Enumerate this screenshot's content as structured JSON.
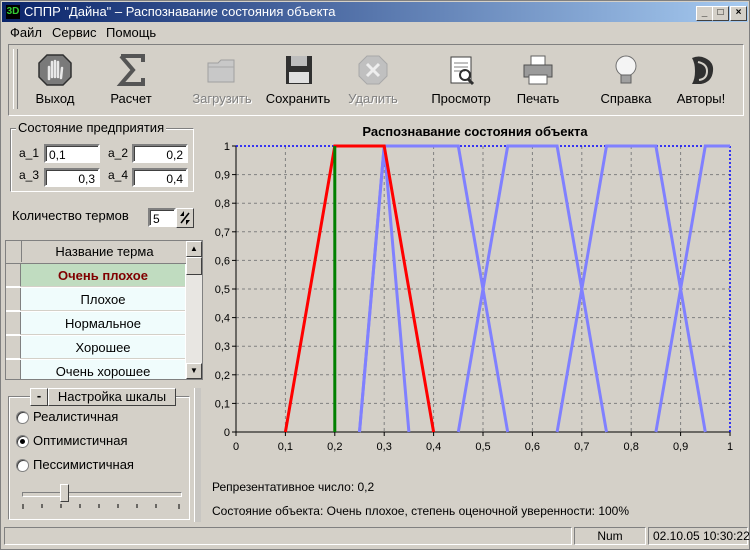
{
  "window": {
    "title": "СППР \"Дайна\" – Распознавание состояния объекта",
    "app_icon_text": "3D",
    "controls": {
      "minimize": "_",
      "maximize": "□",
      "close": "×"
    }
  },
  "menu": [
    "Файл",
    "Сервис",
    "Помощь"
  ],
  "toolbar": [
    {
      "label": "Выход",
      "icon": "exit-hand-icon",
      "enabled": true
    },
    {
      "label": "Расчет",
      "icon": "sigma-icon",
      "enabled": true
    },
    {
      "label": "Загрузить",
      "icon": "folder-icon",
      "enabled": false
    },
    {
      "label": "Сохранить",
      "icon": "floppy-disk-icon",
      "enabled": true
    },
    {
      "label": "Удалить",
      "icon": "delete-icon",
      "enabled": false
    },
    {
      "label": "Просмотр",
      "icon": "preview-icon",
      "enabled": true
    },
    {
      "label": "Печать",
      "icon": "printer-icon",
      "enabled": true
    },
    {
      "label": "Справка",
      "icon": "lightbulb-icon",
      "enabled": true
    },
    {
      "label": "Авторы!",
      "icon": "gothic-d-icon",
      "enabled": true
    }
  ],
  "state_group": {
    "title": "Состояние предприятия",
    "fields": [
      {
        "label": "a_1",
        "value": "0,1"
      },
      {
        "label": "a_2",
        "value": "0,2"
      },
      {
        "label": "a_3",
        "value": "0,3"
      },
      {
        "label": "a_4",
        "value": "0,4"
      }
    ]
  },
  "terms_count": {
    "label": "Количество термов",
    "value": "5"
  },
  "terms_table": {
    "header": "Название терма",
    "rows": [
      "Очень плохое",
      "Плохое",
      "Нормальное",
      "Хорошее",
      "Очень хорошее"
    ],
    "selected_index": 0,
    "selected_color": "#800000",
    "selected_bg": "#c0dcc0"
  },
  "scale_settings": {
    "toggle_label": "-",
    "title": "Настройка шкалы",
    "options": [
      {
        "label": "Реалистичная",
        "checked": false
      },
      {
        "label": "Оптимистичная",
        "checked": true
      },
      {
        "label": "Пессимистичная",
        "checked": false
      }
    ],
    "slider_value": 0.25
  },
  "chart_data": {
    "type": "line",
    "title": "Распознавание состояния объекта",
    "xlim": [
      0,
      1
    ],
    "ylim": [
      0,
      1
    ],
    "x_ticks": [
      "0",
      "0,1",
      "0,2",
      "0,3",
      "0,4",
      "0,5",
      "0,6",
      "0,7",
      "0,8",
      "0,9",
      "1"
    ],
    "y_ticks": [
      "0",
      "0,1",
      "0,2",
      "0,3",
      "0,4",
      "0,5",
      "0,6",
      "0,7",
      "0,8",
      "0,9",
      "1"
    ],
    "grid": true,
    "series": [
      {
        "color": "#8080ff",
        "x": [
          0.25,
          0.3,
          0.35
        ],
        "y": [
          0,
          1,
          0
        ]
      },
      {
        "color": "#8080ff",
        "x": [
          0.25,
          0.3,
          0.45,
          0.55
        ],
        "y": [
          0,
          1,
          1,
          0
        ]
      },
      {
        "color": "#8080ff",
        "x": [
          0.45,
          0.55,
          0.65,
          0.75
        ],
        "y": [
          0,
          1,
          1,
          0
        ]
      },
      {
        "color": "#8080ff",
        "x": [
          0.65,
          0.75,
          0.85,
          0.95
        ],
        "y": [
          0,
          1,
          1,
          0
        ]
      },
      {
        "color": "#8080ff",
        "x": [
          0.85,
          0.95,
          1
        ],
        "y": [
          0,
          1,
          1
        ]
      },
      {
        "color": "#ff0000",
        "x": [
          0.1,
          0.2,
          0.3,
          0.4
        ],
        "y": [
          0,
          1,
          1,
          0
        ]
      },
      {
        "color": "#008000",
        "x": [
          0.2,
          0.2
        ],
        "y": [
          0,
          1
        ]
      }
    ],
    "marker": {
      "color": "#0000ff",
      "x": [
        0,
        1
      ],
      "y": [
        1,
        1
      ]
    }
  },
  "results": {
    "representative": "Репрезентативное число: 0,2",
    "state": "Состояние объекта: Очень плохое, степень оценочной уверенности: 100%"
  },
  "statusbar": {
    "num": "Num",
    "datetime": "02.10.05 10:30:22"
  }
}
